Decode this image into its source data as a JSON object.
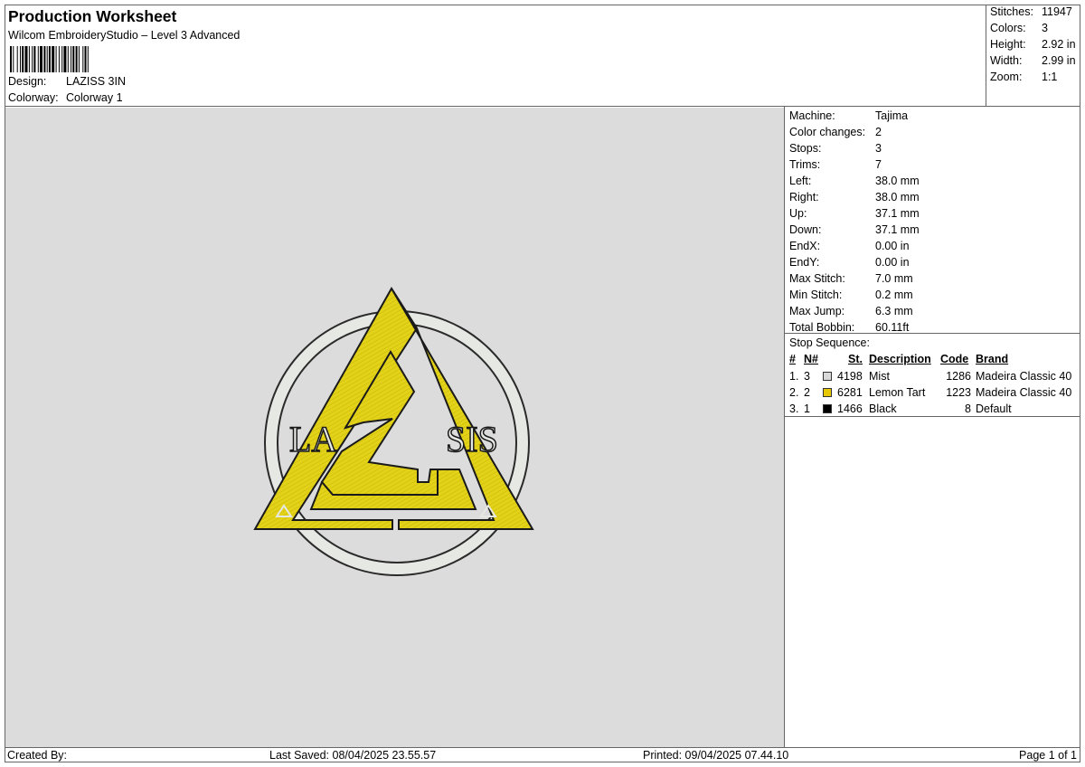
{
  "header": {
    "title": "Production Worksheet",
    "subtitle": "Wilcom EmbroideryStudio – Level 3 Advanced",
    "design_label": "Design:",
    "design_value": "LAZISS 3IN",
    "colorway_label": "Colorway:",
    "colorway_value": "Colorway 1"
  },
  "stats": {
    "stitches_label": "Stitches:",
    "stitches_value": "11947",
    "colors_label": "Colors:",
    "colors_value": "3",
    "height_label": "Height:",
    "height_value": "2.92 in",
    "width_label": "Width:",
    "width_value": "2.99 in",
    "zoom_label": "Zoom:",
    "zoom_value": "1:1"
  },
  "machine": [
    {
      "k": "Machine:",
      "v": "Tajima"
    },
    {
      "k": "Color changes:",
      "v": "2"
    },
    {
      "k": "Stops:",
      "v": "3"
    },
    {
      "k": "Trims:",
      "v": "7"
    },
    {
      "k": "Left:",
      "v": "38.0 mm"
    },
    {
      "k": "Right:",
      "v": "38.0 mm"
    },
    {
      "k": "Up:",
      "v": "37.1 mm"
    },
    {
      "k": "Down:",
      "v": "37.1 mm"
    },
    {
      "k": "EndX:",
      "v": "0.00 in"
    },
    {
      "k": "EndY:",
      "v": "0.00 in"
    },
    {
      "k": "Max Stitch:",
      "v": "7.0 mm"
    },
    {
      "k": "Min Stitch:",
      "v": "0.2 mm"
    },
    {
      "k": "Max Jump:",
      "v": "6.3 mm"
    },
    {
      "k": "Total Bobbin:",
      "v": "60.11ft"
    }
  ],
  "sequence": {
    "title": "Stop Sequence:",
    "headers": {
      "num": "#",
      "n": "N#",
      "st": "St.",
      "desc": "Description",
      "code": "Code",
      "brand": "Brand"
    },
    "rows": [
      {
        "num": "1.",
        "n": "3",
        "color": "#d9d9d9",
        "st": "4198",
        "desc": "Mist",
        "code": "1286",
        "brand": "Madeira Classic 40"
      },
      {
        "num": "2.",
        "n": "2",
        "color": "#e8c800",
        "st": "6281",
        "desc": "Lemon Tart",
        "code": "1223",
        "brand": "Madeira Classic 40"
      },
      {
        "num": "3.",
        "n": "1",
        "color": "#000000",
        "st": "1466",
        "desc": "Black",
        "code": "8",
        "brand": "Default"
      }
    ]
  },
  "logo": {
    "text_left": "LA",
    "text_right": "SIS",
    "colors": {
      "mist": "#e6e8e4",
      "yellow": "#e3d21a",
      "black": "#1a1a1a"
    }
  },
  "footer": {
    "created": "Created By:",
    "saved": "Last Saved: 08/04/2025 23.55.57",
    "printed": "Printed: 09/04/2025 07.44.10",
    "page": "Page 1 of 1"
  }
}
